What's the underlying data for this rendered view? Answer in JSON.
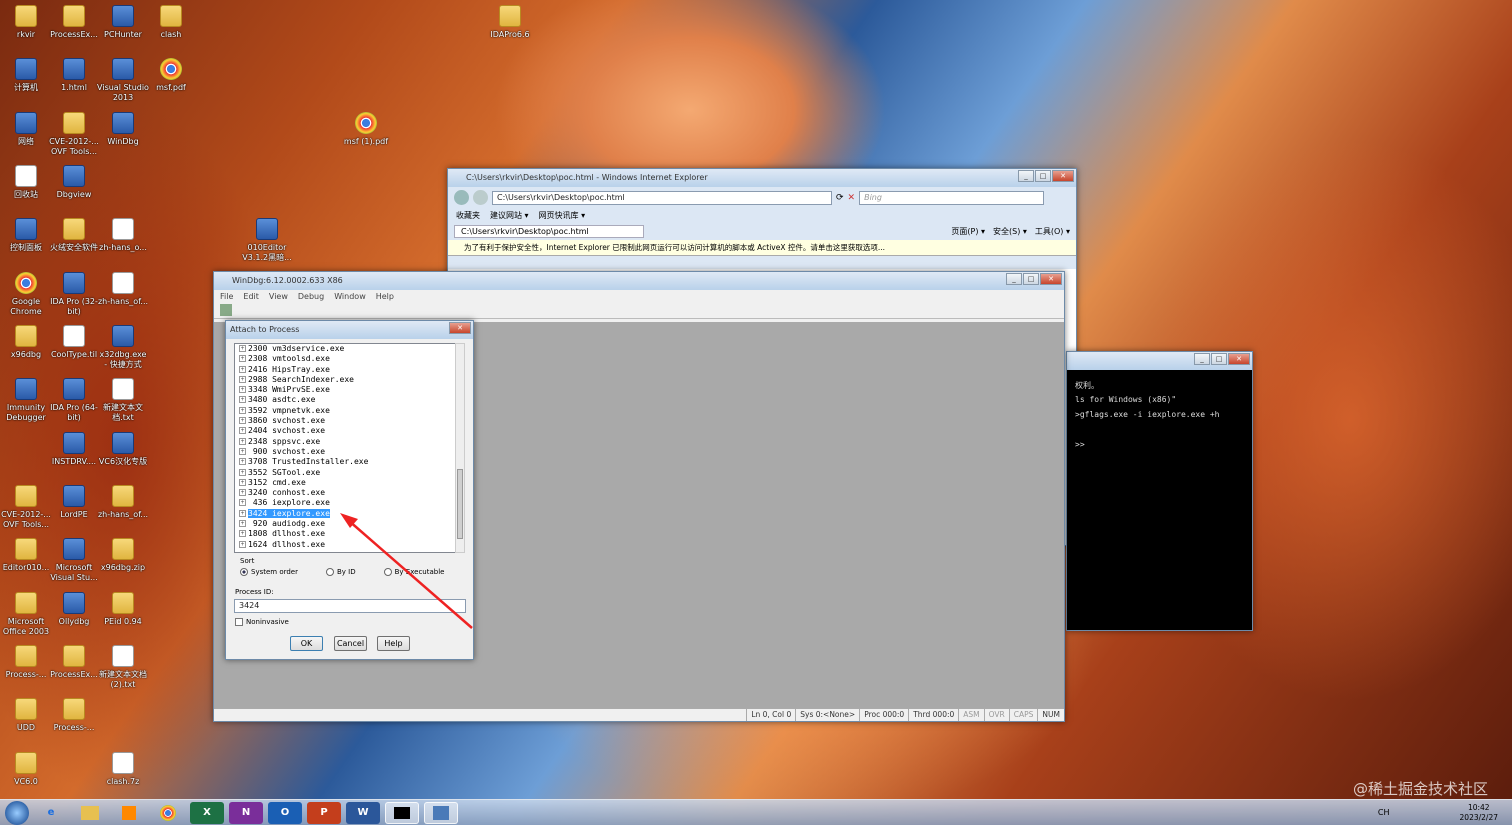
{
  "desktop_icons": [
    {
      "label": "rkvir",
      "kind": "folder"
    },
    {
      "label": "ProcessEx...",
      "kind": "folder"
    },
    {
      "label": "PCHunter",
      "kind": "app"
    },
    {
      "label": "clash",
      "kind": "folder"
    },
    {
      "label": "计算机",
      "kind": "app"
    },
    {
      "label": "1.html",
      "kind": "app"
    },
    {
      "label": "Visual Studio 2013",
      "kind": "app"
    },
    {
      "label": "msf.pdf",
      "kind": "chrome"
    },
    {
      "label": "网络",
      "kind": "app"
    },
    {
      "label": "CVE-2012-... OVF Tools...",
      "kind": "folder"
    },
    {
      "label": "WinDbg",
      "kind": "app"
    },
    {
      "label": "回收站",
      "kind": "doc"
    },
    {
      "label": "Dbgview",
      "kind": "app"
    },
    {
      "label": "控制面板",
      "kind": "app"
    },
    {
      "label": "火绒安全软件",
      "kind": "folder"
    },
    {
      "label": "zh-hans_o...",
      "kind": "doc"
    },
    {
      "label": "Google Chrome",
      "kind": "chrome"
    },
    {
      "label": "IDA Pro (32-bit)",
      "kind": "app"
    },
    {
      "label": "zh-hans_of...",
      "kind": "doc"
    },
    {
      "label": "x96dbg",
      "kind": "folder"
    },
    {
      "label": "CoolType.til",
      "kind": "doc"
    },
    {
      "label": "x32dbg.exe - 快捷方式",
      "kind": "app"
    },
    {
      "label": "Immunity Debugger",
      "kind": "app"
    },
    {
      "label": "IDA Pro (64-bit)",
      "kind": "app"
    },
    {
      "label": "新建文本文档.txt",
      "kind": "doc"
    },
    {
      "label": "INSTDRV....",
      "kind": "app"
    },
    {
      "label": "VC6汉化专版",
      "kind": "app"
    },
    {
      "label": "CVE-2012-... OVF Tools...",
      "kind": "folder"
    },
    {
      "label": "LordPE",
      "kind": "app"
    },
    {
      "label": "zh-hans_of...",
      "kind": "folder"
    },
    {
      "label": "Editor010...",
      "kind": "folder"
    },
    {
      "label": "Microsoft Visual Stu...",
      "kind": "app"
    },
    {
      "label": "x96dbg.zip",
      "kind": "folder"
    },
    {
      "label": "Microsoft Office 2003",
      "kind": "folder"
    },
    {
      "label": "Ollydbg",
      "kind": "app"
    },
    {
      "label": "PEid 0.94",
      "kind": "folder"
    },
    {
      "label": "Process-...",
      "kind": "folder"
    },
    {
      "label": "ProcessEx...",
      "kind": "folder"
    },
    {
      "label": "新建文本文档 (2).txt",
      "kind": "doc"
    },
    {
      "label": "UDD",
      "kind": "folder"
    },
    {
      "label": "Process-...",
      "kind": "folder"
    },
    {
      "label": "VC6.0",
      "kind": "folder"
    },
    {
      "label": "clash.7z",
      "kind": "doc"
    },
    {
      "label": "IDAPro6.6",
      "kind": "folder"
    },
    {
      "label": "msf (1).pdf",
      "kind": "chrome"
    },
    {
      "label": "010Editor V3.1.2黑暗...",
      "kind": "app"
    }
  ],
  "ie": {
    "title": "C:\\Users\\rkvir\\Desktop\\poc.html - Windows Internet Explorer",
    "address": "C:\\Users\\rkvir\\Desktop\\poc.html",
    "search_placeholder": "Bing",
    "fav": "收藏夹",
    "suggest": "建议网站 ▾",
    "slices": "网页快讯库 ▾",
    "tab": "C:\\Users\\rkvir\\Desktop\\poc.html",
    "cmd": [
      "页面(P) ▾",
      "安全(S) ▾",
      "工具(O) ▾"
    ],
    "infobar": "为了有利于保护安全性，Internet Explorer 已限制此网页运行可以访问计算机的脚本或 ActiveX 控件。请单击这里获取选项..."
  },
  "windbg": {
    "title": "WinDbg:6.12.0002.633 X86",
    "menu": [
      "File",
      "Edit",
      "View",
      "Debug",
      "Window",
      "Help"
    ],
    "status": [
      "Ln 0, Col 0",
      "Sys 0:<None>",
      "Proc 000:0",
      "Thrd 000:0",
      "ASM",
      "OVR",
      "CAPS",
      "NUM"
    ]
  },
  "attach": {
    "title": "Attach to Process",
    "processes": [
      "2300 vm3dservice.exe",
      "2308 vmtoolsd.exe",
      "2416 HipsTray.exe",
      "2988 SearchIndexer.exe",
      "3348 WmiPrvSE.exe",
      "3480 asdtc.exe",
      "3592 vmpnetvk.exe",
      "3860 svchost.exe",
      "2404 svchost.exe",
      "2348 sppsvc.exe",
      " 900 svchost.exe",
      "3708 TrustedInstaller.exe",
      "3552 SGTool.exe",
      "3152 cmd.exe",
      "3240 conhost.exe",
      " 436 iexplore.exe",
      "3424 iexplore.exe",
      " 920 audiodg.exe",
      "1808 dllhost.exe",
      "1624 dllhost.exe"
    ],
    "selected_index": 16,
    "sort_label": "Sort",
    "sort_options": [
      "System order",
      "By ID",
      "By Executable"
    ],
    "sort_selected": "System order",
    "pid_label": "Process ID:",
    "pid_value": "3424",
    "noninvasive": "Noninvasive",
    "ok": "OK",
    "cancel": "Cancel",
    "help": "Help"
  },
  "console": {
    "lines": [
      "权利。",
      "ls for Windows (x86)\"",
      ">gflags.exe -i iexplore.exe +h",
      "",
      ">>"
    ]
  },
  "tray": {
    "lang": "CH",
    "time": "10:42",
    "date": "2023/2/27"
  },
  "watermark": "@稀土掘金技术社区"
}
